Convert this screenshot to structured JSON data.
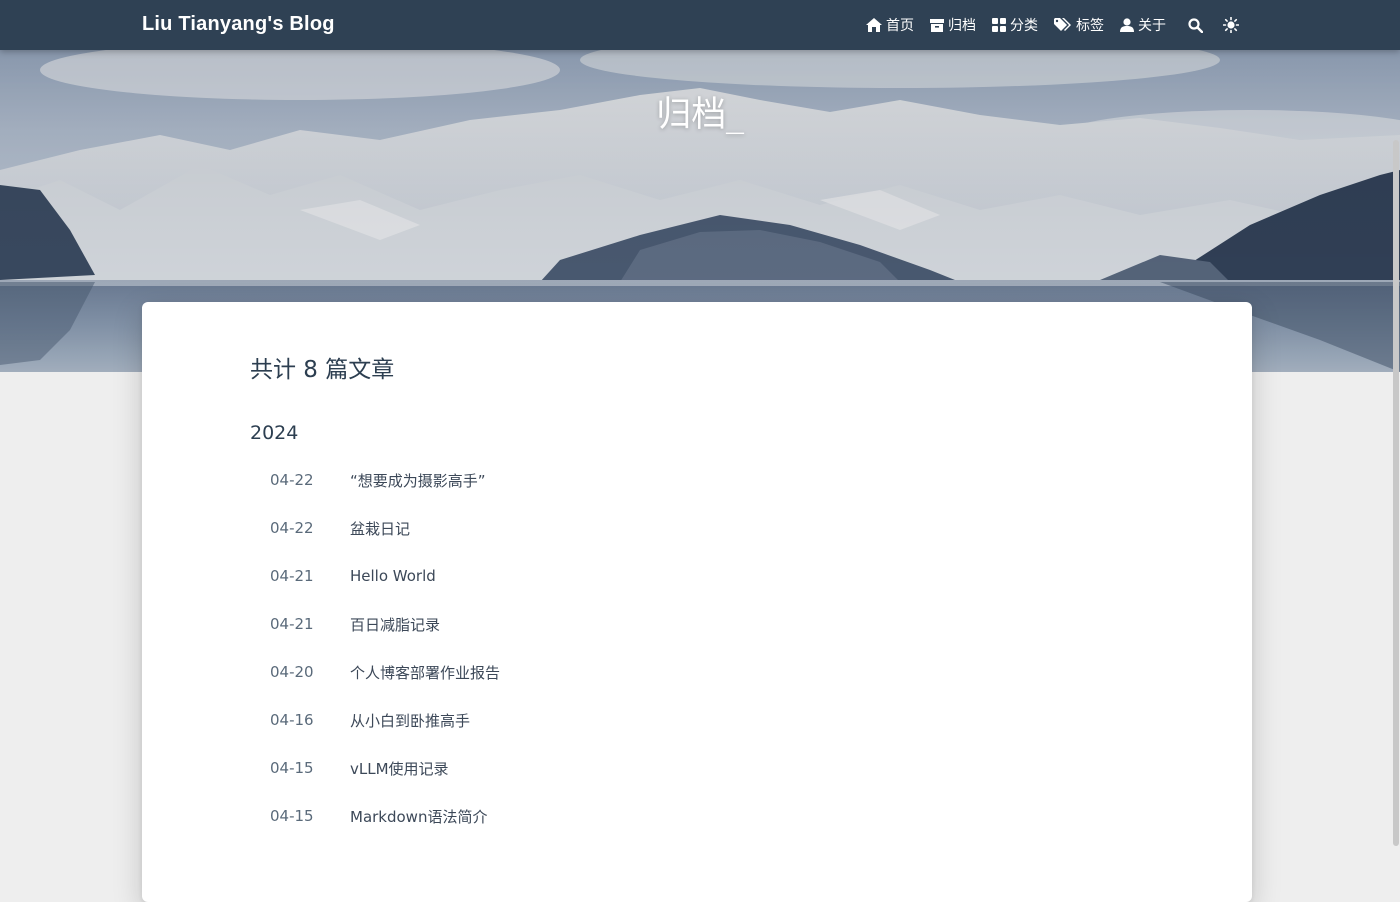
{
  "nav": {
    "brand": "Liu Tianyang's Blog",
    "items": [
      {
        "icon": "home-icon",
        "label": "首页"
      },
      {
        "icon": "archive-icon",
        "label": "归档"
      },
      {
        "icon": "category-icon",
        "label": "分类"
      },
      {
        "icon": "tags-icon",
        "label": "标签"
      },
      {
        "icon": "user-icon",
        "label": "关于"
      }
    ],
    "search_icon": "search-icon",
    "theme_icon": "sun-icon"
  },
  "banner": {
    "title": "归档",
    "cursor": "_"
  },
  "archive": {
    "total": "共计 8 篇文章",
    "year": "2024",
    "posts": [
      {
        "date": "04-22",
        "title": "“想要成为摄影高手”"
      },
      {
        "date": "04-22",
        "title": "盆栽日记"
      },
      {
        "date": "04-21",
        "title": "Hello World"
      },
      {
        "date": "04-21",
        "title": "百日减脂记录"
      },
      {
        "date": "04-20",
        "title": "个人博客部署作业报告"
      },
      {
        "date": "04-16",
        "title": "从小白到卧推高手"
      },
      {
        "date": "04-15",
        "title": "vLLM使用记录"
      },
      {
        "date": "04-15",
        "title": "Markdown语法简介"
      }
    ]
  },
  "colors": {
    "navbar": "#2f4154",
    "page_bg": "#eeeeee",
    "card_bg": "#ffffff",
    "text": "#2c3e50"
  }
}
